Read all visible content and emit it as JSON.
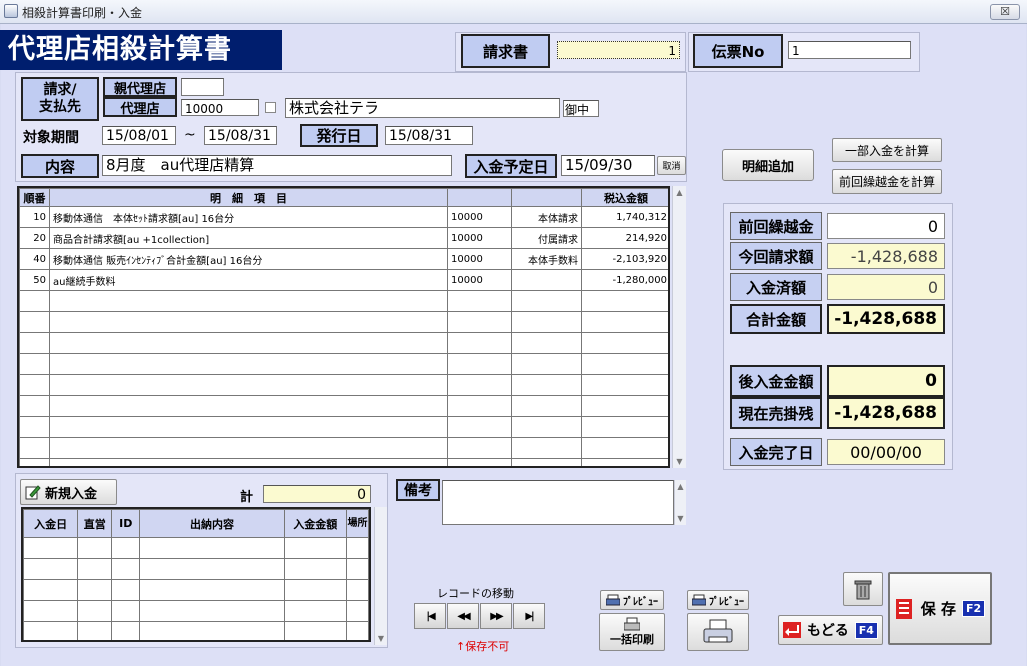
{
  "window": {
    "title": "相殺計算書印刷・入金",
    "close_label": "☒"
  },
  "header": {
    "title": "代理店相殺計算書",
    "invoice_label": "請求書",
    "invoice_value": "1",
    "slip_label": "伝票No",
    "slip_value": "1"
  },
  "form": {
    "billing_label": "請求/\n支払先",
    "parent_agent_label": "親代理店",
    "parent_agent_value": "",
    "agent_label": "代理店",
    "agent_code": "10000",
    "company_name": "株式会社テラ",
    "honorific": "御中",
    "period_label": "対象期間",
    "period_from": "15/08/01",
    "period_sep": "~",
    "period_to": "15/08/31",
    "issue_label": "発行日",
    "issue_date": "15/08/31",
    "content_label": "内容",
    "content_value": "8月度　au代理店精算",
    "due_label": "入金予定日",
    "due_date": "15/09/30",
    "cancel_label": "取消"
  },
  "buttons": {
    "add_detail": "明細追加",
    "partial_payment": "一部入金を計算",
    "carry_over": "前回繰越金を計算",
    "new_payment": "新規入金",
    "preview1": "ﾌﾟﾚﾋﾞｭｰ",
    "preview2": "ﾌﾟﾚﾋﾞｭｰ",
    "batch_print": "一括印刷",
    "back": "もどる",
    "back_key": "F4",
    "save": "保 存",
    "save_key": "F2"
  },
  "detail_table": {
    "headers": {
      "seq": "順番",
      "item": "明　細　項　目",
      "code": "",
      "type": "",
      "amount": "税込金額"
    },
    "rows": [
      {
        "seq": "10",
        "item": "移動体通信　本体ｾｯﾄ請求額[au] 16台分",
        "code": "10000",
        "type": "本体請求",
        "amount": "1,740,312"
      },
      {
        "seq": "20",
        "item": "商品合計請求額[au +1collection]",
        "code": "10000",
        "type": "付属請求",
        "amount": "214,920"
      },
      {
        "seq": "40",
        "item": "移動体通信 販売ｲﾝｾﾝﾃｨﾌﾞ合計金額[au] 16台分",
        "code": "10000",
        "type": "本体手数料",
        "amount": "-2,103,920"
      },
      {
        "seq": "50",
        "item": "au継続手数料",
        "code": "10000",
        "type": "",
        "amount": "-1,280,000"
      }
    ]
  },
  "summary": {
    "prev_carry_label": "前回繰越金",
    "prev_carry_value": "0",
    "current_bill_label": "今回請求額",
    "current_bill_value": "-1,428,688",
    "paid_label": "入金済額",
    "paid_value": "0",
    "total_label": "合計金額",
    "total_value": "-1,428,688",
    "post_payment_label": "後入金金額",
    "post_payment_value": "0",
    "receivable_label": "現在売掛残",
    "receivable_value": "-1,428,688",
    "complete_label": "入金完了日",
    "complete_value": "00/00/00"
  },
  "payments": {
    "total_label": "計",
    "total_value": "0",
    "headers": {
      "date": "入金日",
      "direct": "直営",
      "id": "ID",
      "content": "出納内容",
      "amount": "入金金額",
      "place": "場所"
    }
  },
  "remarks": {
    "label": "備考",
    "value": ""
  },
  "record_nav": {
    "label": "レコードの移動",
    "note": "↑保存不可"
  }
}
